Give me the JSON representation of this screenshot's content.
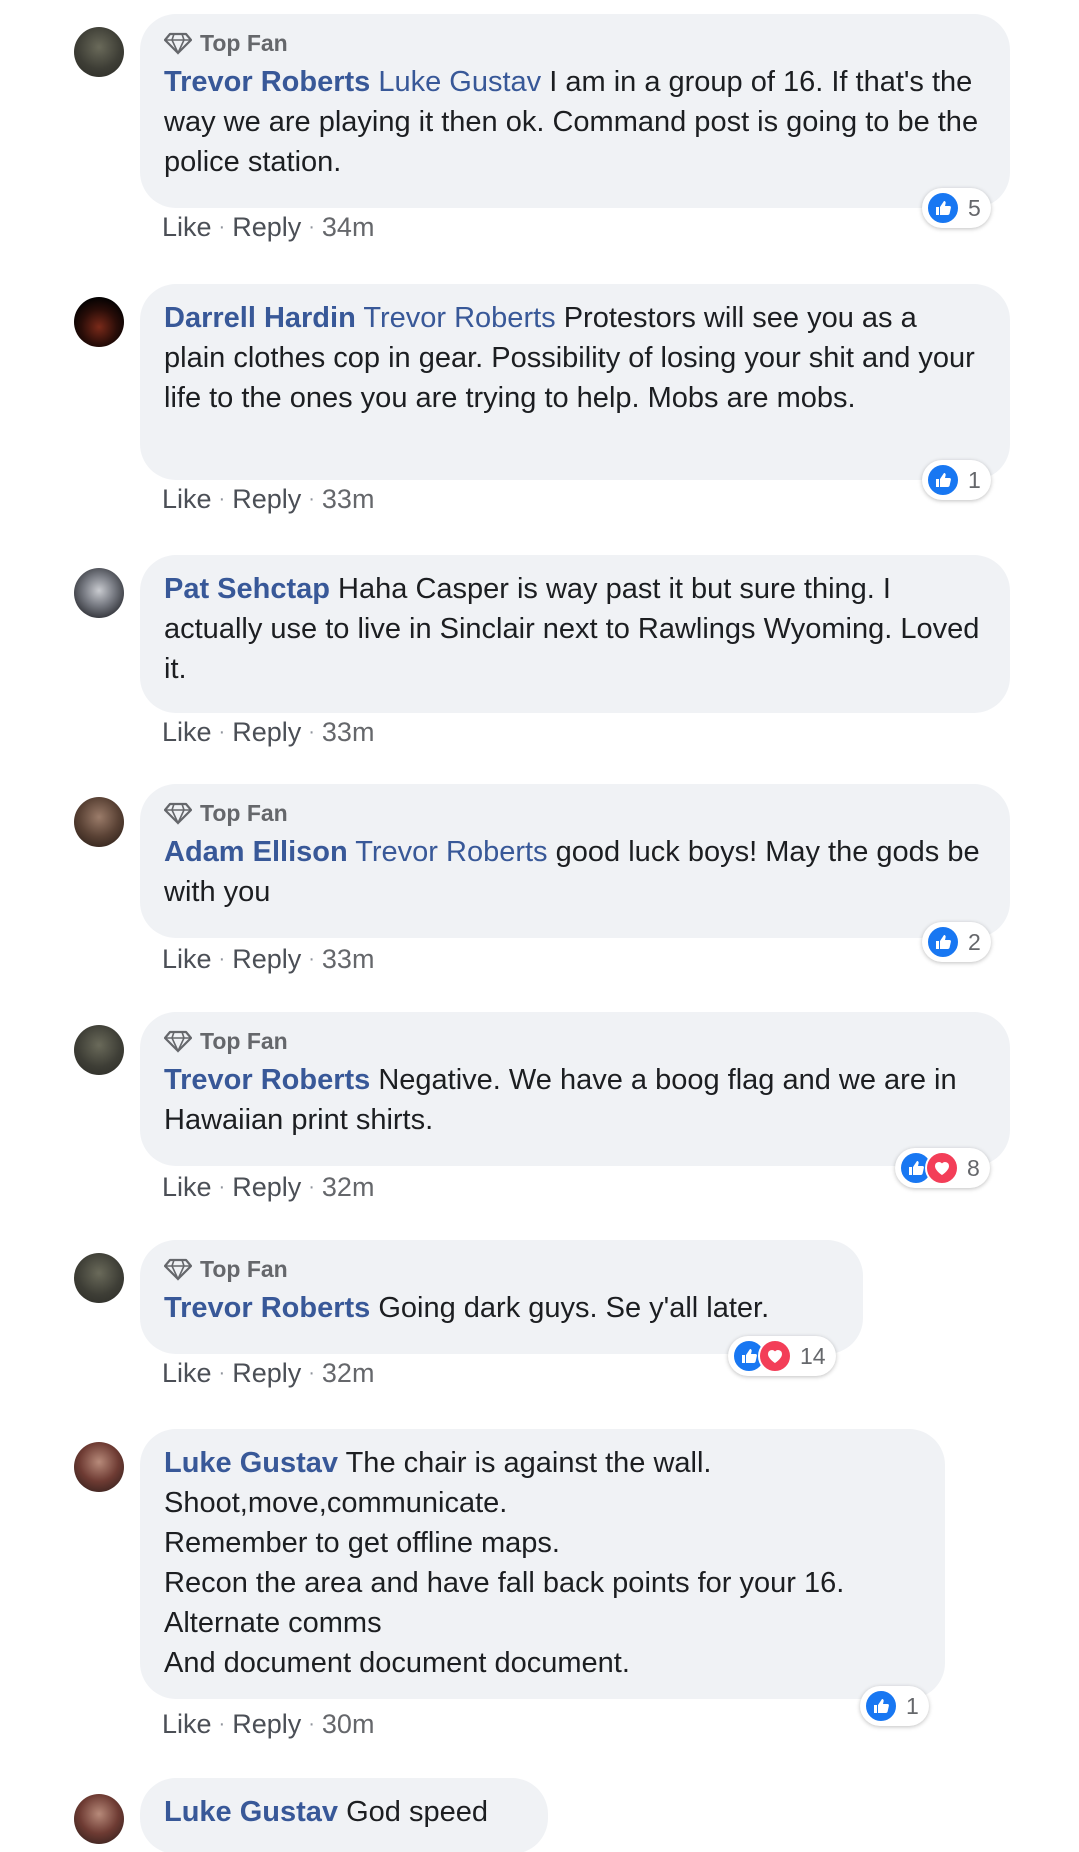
{
  "colors": {
    "name_link": "#385898",
    "like_blue": "#1877f2",
    "love_red": "#f33e58",
    "bubble_bg": "#f0f2f5"
  },
  "badge_label": "Top Fan",
  "actions": {
    "like": "Like",
    "reply": "Reply"
  },
  "comments": [
    {
      "author": "Trevor Roberts",
      "top_fan": true,
      "tag": "Luke Gustav",
      "text": " I am in a group of 16. If that's the way we are playing it then ok. Command post is going to be the police station.",
      "time": "34m",
      "reactions": [
        "like"
      ],
      "reaction_count": "5"
    },
    {
      "author": "Darrell Hardin",
      "top_fan": false,
      "tag": "Trevor Roberts",
      "text": " Protestors will see you as a plain clothes cop in gear. Possibility of losing your shit and your life to the ones you are trying to help. Mobs are mobs.",
      "time": "33m",
      "reactions": [
        "like"
      ],
      "reaction_count": "1"
    },
    {
      "author": "Pat Sehctap",
      "top_fan": false,
      "tag": "",
      "text": " Haha Casper is way past it but sure thing. I actually use to live in Sinclair next to Rawlings Wyoming. Loved it.",
      "time": "33m",
      "reactions": [],
      "reaction_count": ""
    },
    {
      "author": "Adam Ellison",
      "top_fan": true,
      "tag": "Trevor Roberts",
      "text": " good luck boys! May the gods be with you",
      "time": "33m",
      "reactions": [
        "like"
      ],
      "reaction_count": "2"
    },
    {
      "author": "Trevor Roberts",
      "top_fan": true,
      "tag": "",
      "text": " Negative. We have a boog flag and we are in Hawaiian print shirts.",
      "time": "32m",
      "reactions": [
        "like",
        "love"
      ],
      "reaction_count": "8"
    },
    {
      "author": "Trevor Roberts",
      "top_fan": true,
      "tag": "",
      "text": " Going dark guys. Se y'all later.",
      "time": "32m",
      "reactions": [
        "like",
        "love"
      ],
      "reaction_count": "14"
    },
    {
      "author": "Luke Gustav",
      "top_fan": false,
      "tag": "",
      "text": " The chair is against the wall.\nShoot,move,communicate.\nRemember to get offline maps.\nRecon the area and have fall back points for your 16.\nAlternate comms\nAnd document document document.",
      "time": "30m",
      "reactions": [
        "like"
      ],
      "reaction_count": "1"
    },
    {
      "author": "Luke Gustav",
      "top_fan": false,
      "tag": "",
      "text": " God speed",
      "time": "",
      "reactions": [],
      "reaction_count": ""
    }
  ]
}
